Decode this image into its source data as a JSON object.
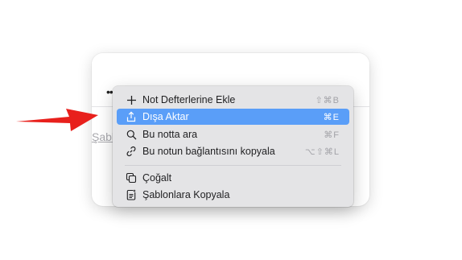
{
  "background": {
    "link_text": "Şabl"
  },
  "toolbar": {
    "more_icon": "ellipsis-icon"
  },
  "menu": {
    "items": [
      {
        "label": "Not Defterlerine Ekle",
        "shortcut": "⇧⌘B",
        "icon": "plus-icon"
      },
      {
        "label": "Dışa Aktar",
        "shortcut": "⌘E",
        "icon": "share-upload-icon",
        "highlighted": true
      },
      {
        "label": "Bu notta ara",
        "shortcut": "⌘F",
        "icon": "magnifier-icon"
      },
      {
        "label": "Bu notun bağlantısını kopyala",
        "shortcut": "⌥⇧⌘L",
        "icon": "link-icon"
      },
      {
        "label": "Çoğalt",
        "shortcut": "",
        "icon": "duplicate-icon"
      },
      {
        "label": "Şablonlara Kopyala",
        "shortcut": "",
        "icon": "template-doc-icon"
      }
    ]
  },
  "colors": {
    "highlight": "#5a9ef8",
    "arrow": "#e8201c",
    "menu_bg": "#e4e4e6"
  }
}
